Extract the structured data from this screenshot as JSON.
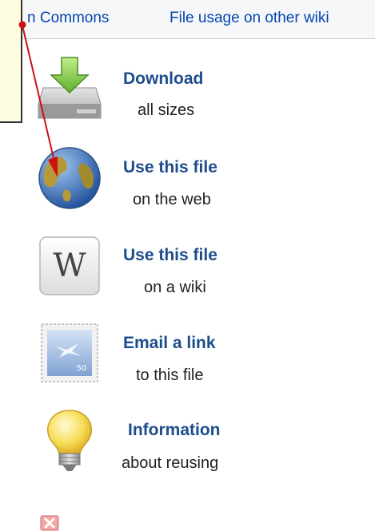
{
  "tabs": {
    "commons": "n Commons",
    "usage": "File usage on other wiki"
  },
  "items": [
    {
      "title": "Download",
      "sub": "all sizes",
      "icon": "download-drive-icon"
    },
    {
      "title": "Use this file",
      "sub": "on the web",
      "icon": "globe-icon"
    },
    {
      "title": "Use this file",
      "sub": "on a wiki",
      "icon": "wikipedia-icon"
    },
    {
      "title": "Email a link",
      "sub": "to this file",
      "icon": "email-stamp-icon"
    },
    {
      "title": "Information",
      "sub": "about reusing",
      "icon": "lightbulb-icon"
    }
  ],
  "colors": {
    "link": "#0645ad",
    "title": "#1d4d8c",
    "annotation_arrow": "#cc1111",
    "tooltip_bg": "#fffde0"
  }
}
